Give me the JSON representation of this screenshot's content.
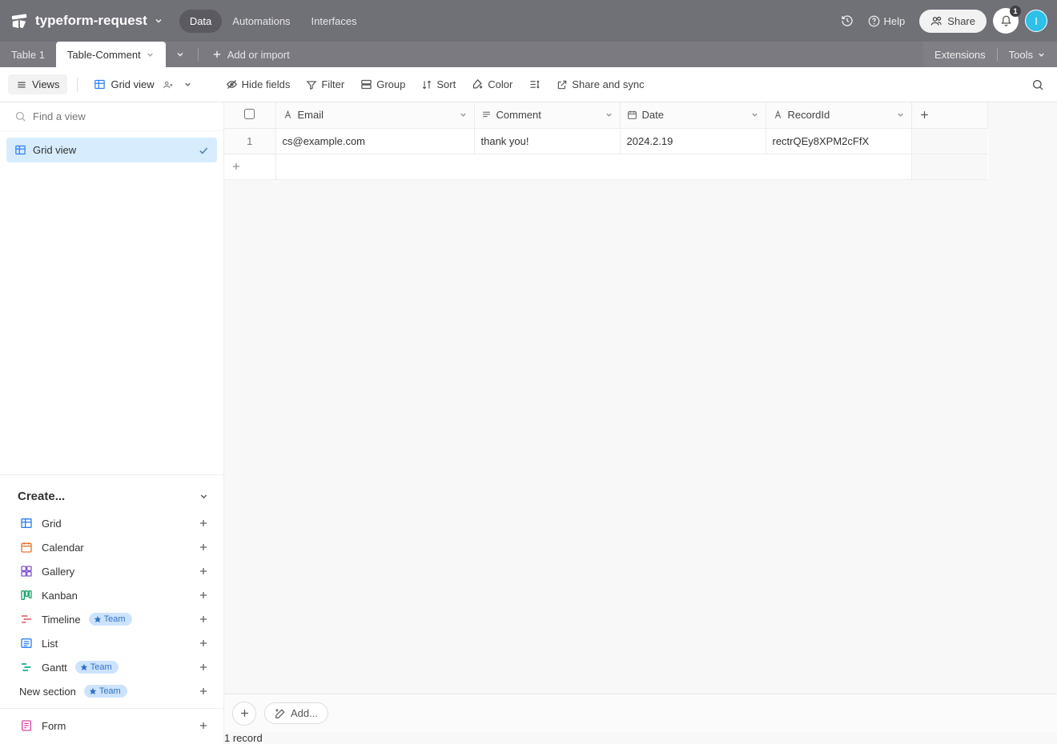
{
  "topbar": {
    "base_name": "typeform-request",
    "nav": {
      "data": "Data",
      "automations": "Automations",
      "interfaces": "Interfaces"
    },
    "help": "Help",
    "share": "Share",
    "notif_count": "1",
    "avatar_initial": "I"
  },
  "tabs": {
    "items": [
      {
        "label": "Table 1",
        "active": false
      },
      {
        "label": "Table-Comment",
        "active": true
      }
    ],
    "add_import": "Add or import",
    "extensions": "Extensions",
    "tools": "Tools"
  },
  "toolbar": {
    "views": "Views",
    "gridview": "Grid view",
    "hide_fields": "Hide fields",
    "filter": "Filter",
    "group": "Group",
    "sort": "Sort",
    "color": "Color",
    "share_sync": "Share and sync"
  },
  "sidebar": {
    "find_placeholder": "Find a view",
    "active_view": "Grid view",
    "create_label": "Create...",
    "items": {
      "grid": "Grid",
      "calendar": "Calendar",
      "gallery": "Gallery",
      "kanban": "Kanban",
      "timeline": "Timeline",
      "list": "List",
      "gantt": "Gantt",
      "new_section": "New section",
      "form": "Form"
    },
    "team_badge": "Team"
  },
  "table": {
    "columns": {
      "email": "Email",
      "comment": "Comment",
      "date": "Date",
      "recordid": "RecordId"
    },
    "rows": [
      {
        "n": "1",
        "email": "cs@example.com",
        "comment": "thank you!",
        "date": "2024.2.19",
        "recordid": "rectrQEy8XPM2cFfX"
      }
    ]
  },
  "footer": {
    "add": "Add...",
    "count": "1 record"
  }
}
